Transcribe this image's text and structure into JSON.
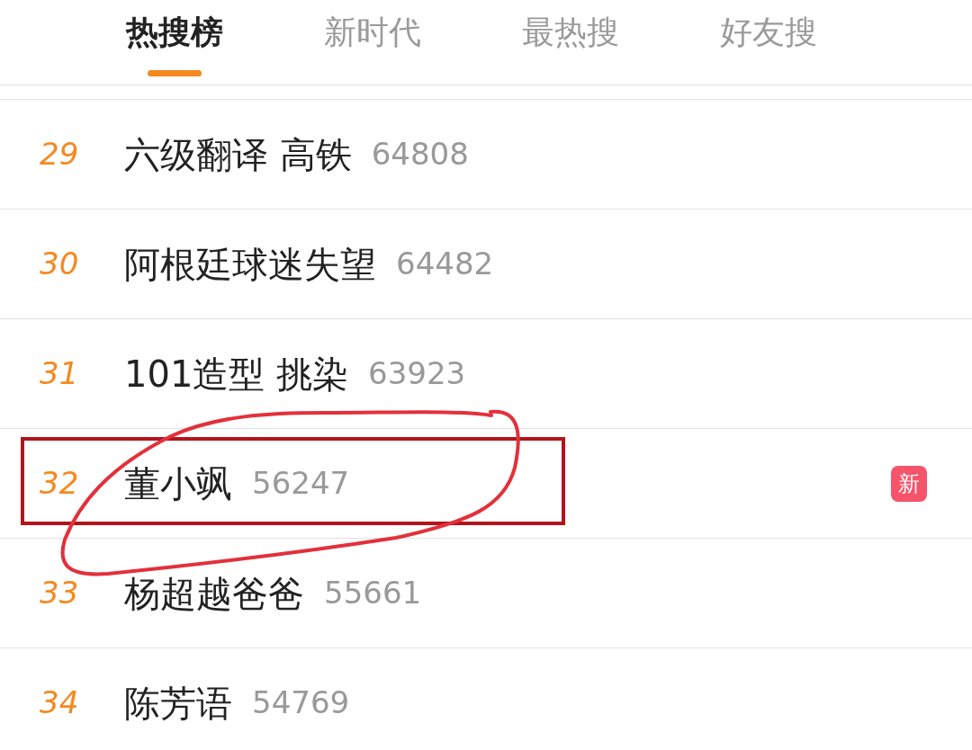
{
  "tabs": [
    {
      "label": "热搜榜",
      "selected": true
    },
    {
      "label": "新时代",
      "selected": false
    },
    {
      "label": "最热搜",
      "selected": false
    },
    {
      "label": "好友搜",
      "selected": false
    }
  ],
  "rows": [
    {
      "rank": "29",
      "title": "六级翻译 高铁",
      "count": "64808"
    },
    {
      "rank": "30",
      "title": "阿根廷球迷失望",
      "count": "64482"
    },
    {
      "rank": "31",
      "title": "101造型 挑染",
      "count": "63923"
    },
    {
      "rank": "32",
      "title": "董小飒",
      "count": "56247",
      "badge": "新"
    },
    {
      "rank": "33",
      "title": "杨超越爸爸",
      "count": "55661"
    },
    {
      "rank": "34",
      "title": "陈芳语",
      "count": "54769"
    }
  ]
}
